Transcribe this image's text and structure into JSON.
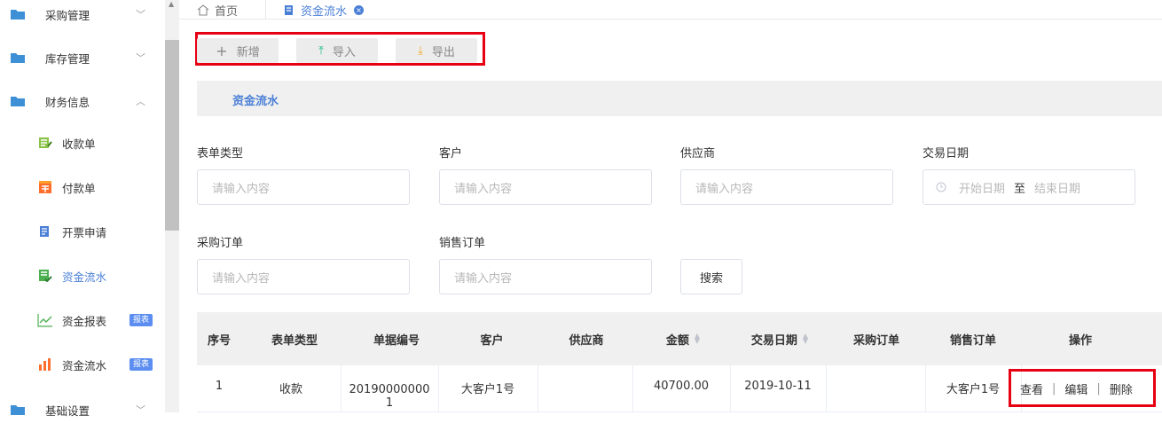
{
  "sidebar": {
    "groups": [
      {
        "label": "采购管理",
        "chevron": "chevron-down"
      },
      {
        "label": "库存管理",
        "chevron": "chevron-down"
      },
      {
        "label": "财务信息",
        "chevron": "chevron-up"
      }
    ],
    "items": [
      {
        "label": "收款单",
        "icon": "receipt-icon"
      },
      {
        "label": "付款单",
        "icon": "payment-icon"
      },
      {
        "label": "开票申请",
        "icon": "invoice-icon"
      },
      {
        "label": "资金流水",
        "icon": "cashflow-icon",
        "active": true
      },
      {
        "label": "资金报表",
        "icon": "line-chart-icon",
        "badge": "报表"
      },
      {
        "label": "资金流水",
        "icon": "bar-chart-icon",
        "badge": "报表"
      }
    ],
    "bottom_group": {
      "label": "基础设置"
    }
  },
  "tabs": {
    "home": "首页",
    "active": "资金流水"
  },
  "toolbar": {
    "add": "新增",
    "import": "导入",
    "export": "导出"
  },
  "panel": {
    "title": "资金流水"
  },
  "filters": {
    "form_type": {
      "label": "表单类型",
      "placeholder": "请输入内容"
    },
    "customer": {
      "label": "客户",
      "placeholder": "请输入内容"
    },
    "supplier": {
      "label": "供应商",
      "placeholder": "请输入内容"
    },
    "trade_date": {
      "label": "交易日期",
      "start": "开始日期",
      "sep": "至",
      "end": "结束日期"
    },
    "purchase_order": {
      "label": "采购订单",
      "placeholder": "请输入内容"
    },
    "sales_order": {
      "label": "销售订单",
      "placeholder": "请输入内容"
    },
    "search": "搜索"
  },
  "table": {
    "headers": [
      "序号",
      "表单类型",
      "单据编号",
      "客户",
      "供应商",
      "金额",
      "交易日期",
      "采购订单",
      "销售订单",
      "操作"
    ],
    "rows": [
      {
        "index": "1",
        "type": "收款",
        "number_line1": "20190000000",
        "number_line2": "1",
        "customer": "大客户1号",
        "supplier": "",
        "amount": "40700.00",
        "date": "2019-10-11",
        "purchase": "",
        "sales": "大客户1号"
      }
    ],
    "actions": {
      "view": "查看",
      "edit": "编辑",
      "delete": "删除"
    }
  },
  "colors": {
    "accent": "#4a7fd6",
    "highlight": "#e60012",
    "badge": "#5b8ef0"
  }
}
